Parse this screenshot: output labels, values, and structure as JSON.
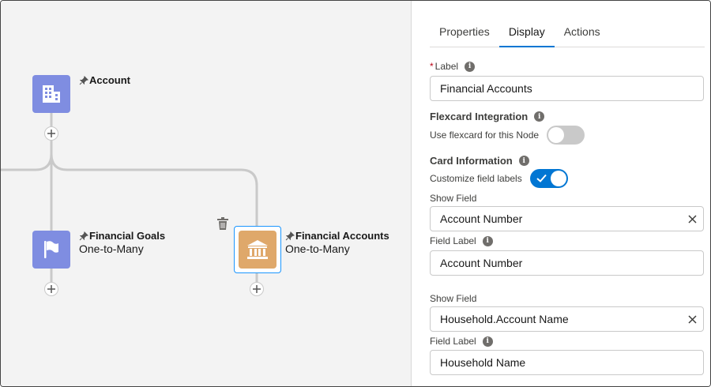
{
  "canvas": {
    "nodes": [
      {
        "id": "account",
        "title": "Account",
        "subtitle": "",
        "icon": "building-icon",
        "color": "#7f8de1"
      },
      {
        "id": "financial-goals",
        "title": "Financial Goals",
        "subtitle": "One-to-Many",
        "icon": "flag-icon",
        "color": "#7f8de1"
      },
      {
        "id": "financial-accounts",
        "title": "Financial Accounts",
        "subtitle": "One-to-Many",
        "icon": "bank-icon",
        "color": "#dfa86a"
      }
    ]
  },
  "panel": {
    "tabs": [
      {
        "label": "Properties",
        "active": false
      },
      {
        "label": "Display",
        "active": true
      },
      {
        "label": "Actions",
        "active": false
      }
    ],
    "label_field": {
      "label": "Label",
      "required_mark": "*",
      "value": "Financial Accounts"
    },
    "flexcard": {
      "heading": "Flexcard Integration",
      "toggle_label": "Use flexcard for this Node",
      "enabled": false
    },
    "card_info": {
      "heading": "Card Information",
      "toggle_label": "Customize field labels",
      "enabled": true
    },
    "fields": [
      {
        "show_label": "Show Field",
        "show_value": "Account Number",
        "label_label": "Field Label",
        "label_value": "Account Number"
      },
      {
        "show_label": "Show Field",
        "show_value": "Household.Account Name",
        "label_label": "Field Label",
        "label_value": "Household Name"
      }
    ]
  },
  "colors": {
    "accent": "#0176d3",
    "selection": "#1b96ff",
    "node_purple": "#7f8de1",
    "node_orange": "#dfa86a"
  }
}
